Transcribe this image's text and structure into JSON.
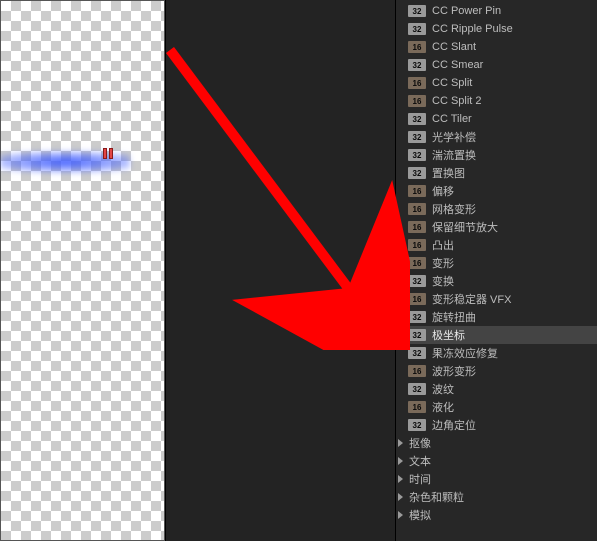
{
  "preview": {
    "beam_color": "#3c5aff"
  },
  "effects": [
    {
      "badge": "32",
      "label": "CC Power Pin"
    },
    {
      "badge": "32",
      "label": "CC Ripple Pulse"
    },
    {
      "badge": "16",
      "label": "CC Slant"
    },
    {
      "badge": "32",
      "label": "CC Smear"
    },
    {
      "badge": "16",
      "label": "CC Split"
    },
    {
      "badge": "16",
      "label": "CC Split 2"
    },
    {
      "badge": "32",
      "label": "CC Tiler"
    },
    {
      "badge": "32",
      "label": "光学补偿"
    },
    {
      "badge": "32",
      "label": "湍流置换"
    },
    {
      "badge": "32",
      "label": "置换图"
    },
    {
      "badge": "16",
      "label": "偏移"
    },
    {
      "badge": "16",
      "label": "网格变形"
    },
    {
      "badge": "16",
      "label": "保留细节放大"
    },
    {
      "badge": "16",
      "label": "凸出"
    },
    {
      "badge": "16",
      "label": "变形"
    },
    {
      "badge": "32",
      "label": "变换"
    },
    {
      "badge": "16",
      "label": "变形稳定器 VFX"
    },
    {
      "badge": "32",
      "label": "旋转扭曲"
    },
    {
      "badge": "32",
      "label": "极坐标",
      "selected": true
    },
    {
      "badge": "32",
      "label": "果冻效应修复"
    },
    {
      "badge": "16",
      "label": "波形变形"
    },
    {
      "badge": "32",
      "label": "波纹"
    },
    {
      "badge": "16",
      "label": "液化"
    },
    {
      "badge": "32",
      "label": "边角定位"
    }
  ],
  "categories": [
    {
      "label": "抠像"
    },
    {
      "label": "文本"
    },
    {
      "label": "时间"
    },
    {
      "label": "杂色和颗粒"
    },
    {
      "label": "模拟"
    }
  ]
}
